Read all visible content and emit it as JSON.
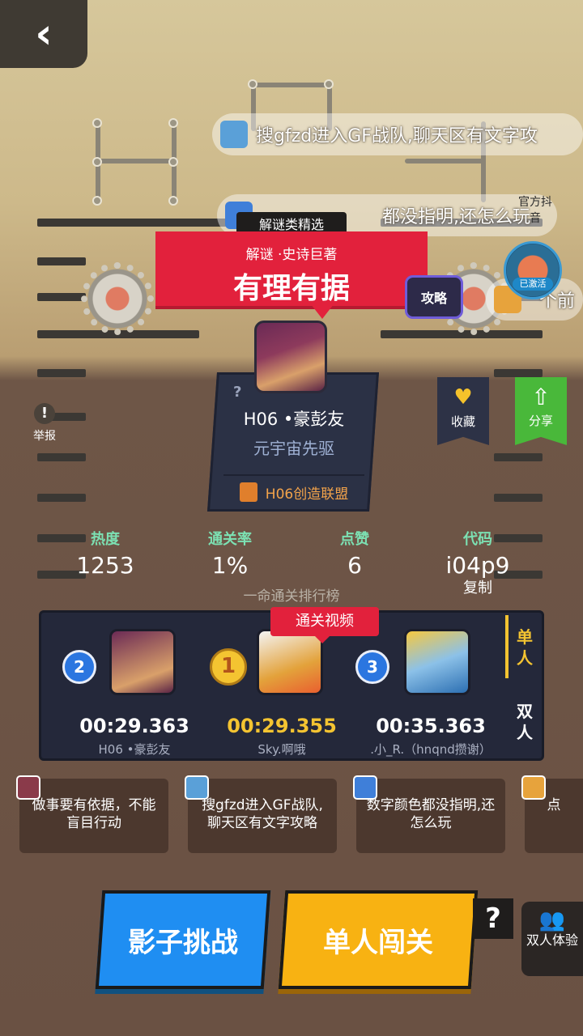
{
  "nav": {
    "back_glyph": "‹"
  },
  "danmaku": [
    {
      "text": "搜gfzd进入GF战队,聊天区有文字攻",
      "avatar_color": "#5aa0d8"
    },
    {
      "text": "都没指明,还怎么玩",
      "avatar_color": "#3f7fd9"
    },
    {
      "text": "个前",
      "avatar_color": "#e7a33c"
    }
  ],
  "header": {
    "category_tag": "解谜类精选",
    "subtitle": "解谜 ·史诗巨著",
    "title": "有理有据"
  },
  "level": {
    "unknown_mark": "?",
    "name": "H06 •豪彭友",
    "desc": "元宇宙先驱",
    "team": "H06创造联盟"
  },
  "side": {
    "guide_label": "攻略",
    "official_label": "官方抖音",
    "activated_label": "已激活",
    "report_label": "举报",
    "favorite_label": "收藏",
    "share_label": "分享"
  },
  "stats": [
    {
      "label": "热度",
      "value": "1253"
    },
    {
      "label": "通关率",
      "value": "1%"
    },
    {
      "label": "点赞",
      "value": "6"
    },
    {
      "label": "代码",
      "value": "i04p9"
    }
  ],
  "copy_label": "复制",
  "rank_title": "一命通关排行榜",
  "video_tag": "通关视频",
  "leaderboard": [
    {
      "rank": "2",
      "time": "00:29.363",
      "name": "H06 •豪彭友"
    },
    {
      "rank": "1",
      "time": "00:29.355",
      "name": "Sky.啊哦"
    },
    {
      "rank": "3",
      "time": "00:35.363",
      "name": ".小_R.（hnqnd攒谢）"
    }
  ],
  "modes": {
    "single": "单人",
    "double": "双人"
  },
  "comments": [
    {
      "text": "做事要有依据，不能盲目行动",
      "avatar_color": "#8a3a4a"
    },
    {
      "text": "搜gfzd进入GF战队,聊天区有文字攻略",
      "avatar_color": "#5aa0d8"
    },
    {
      "text": "数字颜色都没指明,还怎么玩",
      "avatar_color": "#3f7fd9"
    },
    {
      "text": "点",
      "avatar_color": "#e7a33c"
    }
  ],
  "buttons": {
    "shadow": "影子挑战",
    "single": "单人闯关",
    "help": "?",
    "duo": "双人体验"
  },
  "colors": {
    "accent_red": "#e2213c",
    "gold": "#f4c431",
    "blue_button": "#1f8ef2",
    "yellow_button": "#f8b212",
    "stat_label": "#7ce1b3"
  }
}
